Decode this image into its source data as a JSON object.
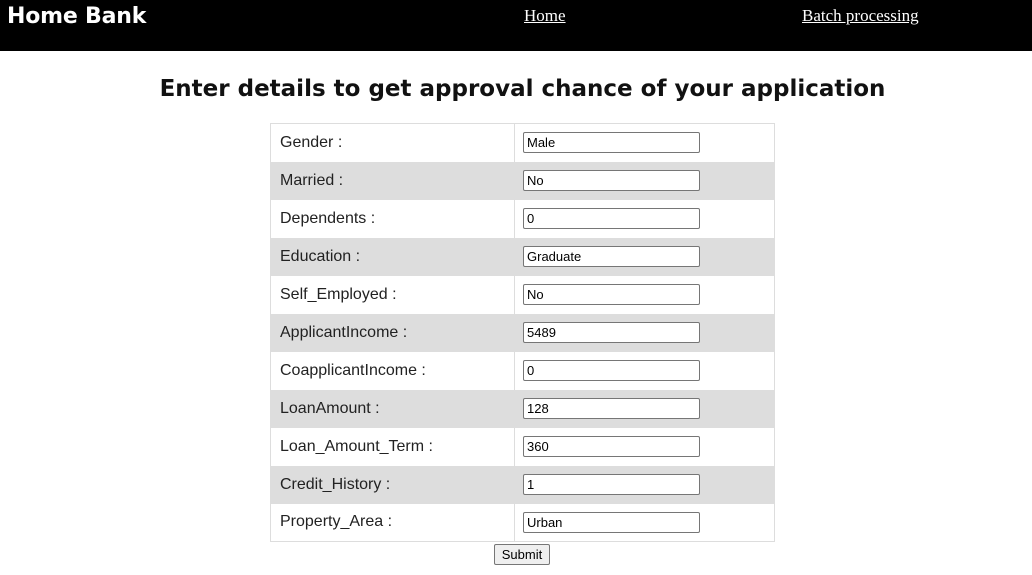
{
  "navbar": {
    "brand": "Home Bank",
    "links": {
      "home": "Home",
      "batch": "Batch processing"
    }
  },
  "page": {
    "title": "Enter details to get approval chance of your application"
  },
  "form": {
    "fields": [
      {
        "label": "Gender :",
        "value": "Male"
      },
      {
        "label": "Married :",
        "value": "No"
      },
      {
        "label": "Dependents :",
        "value": "0"
      },
      {
        "label": "Education :",
        "value": "Graduate"
      },
      {
        "label": "Self_Employed :",
        "value": "No"
      },
      {
        "label": "ApplicantIncome :",
        "value": "5489"
      },
      {
        "label": "CoapplicantIncome :",
        "value": "0"
      },
      {
        "label": "LoanAmount :",
        "value": "128"
      },
      {
        "label": "Loan_Amount_Term :",
        "value": "360"
      },
      {
        "label": "Credit_History :",
        "value": "1"
      },
      {
        "label": "Property_Area :",
        "value": "Urban"
      }
    ],
    "submit_label": "Submit"
  },
  "colors": {
    "navbar_bg": "#000000",
    "row_alt_bg": "#dddddd"
  }
}
